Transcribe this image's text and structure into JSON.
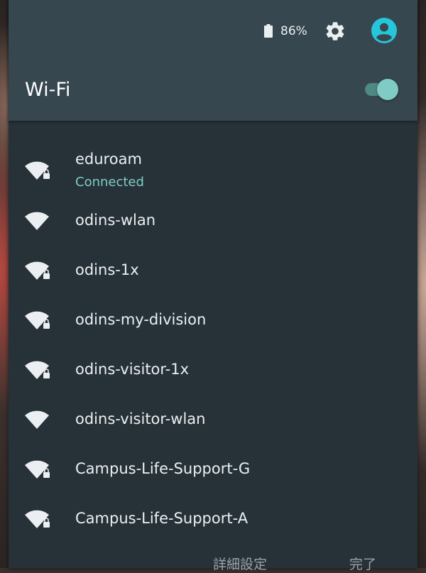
{
  "status_bar": {
    "battery_icon": "battery-icon",
    "battery_text": "86%",
    "settings_icon": "gear-icon",
    "avatar_icon": "account-circle-icon"
  },
  "header": {
    "title": "Wi-Fi",
    "toggle_state": "on"
  },
  "networks": [
    {
      "name": "eduroam",
      "status": "Connected",
      "secured": true
    },
    {
      "name": "odins-wlan",
      "status": "",
      "secured": false
    },
    {
      "name": "odins-1x",
      "status": "",
      "secured": true
    },
    {
      "name": "odins-my-division",
      "status": "",
      "secured": true
    },
    {
      "name": "odins-visitor-1x",
      "status": "",
      "secured": true
    },
    {
      "name": "odins-visitor-wlan",
      "status": "",
      "secured": false
    },
    {
      "name": "Campus-Life-Support-G",
      "status": "",
      "secured": true
    },
    {
      "name": "Campus-Life-Support-A",
      "status": "",
      "secured": true
    }
  ],
  "footer": {
    "more_settings_label": "詳細設定",
    "done_label": "完了"
  },
  "colors": {
    "panel_bg": "#263238",
    "header_bg": "#37474f",
    "accent": "#80cbc4",
    "avatar": "#26c6da",
    "text": "#eceff1"
  }
}
